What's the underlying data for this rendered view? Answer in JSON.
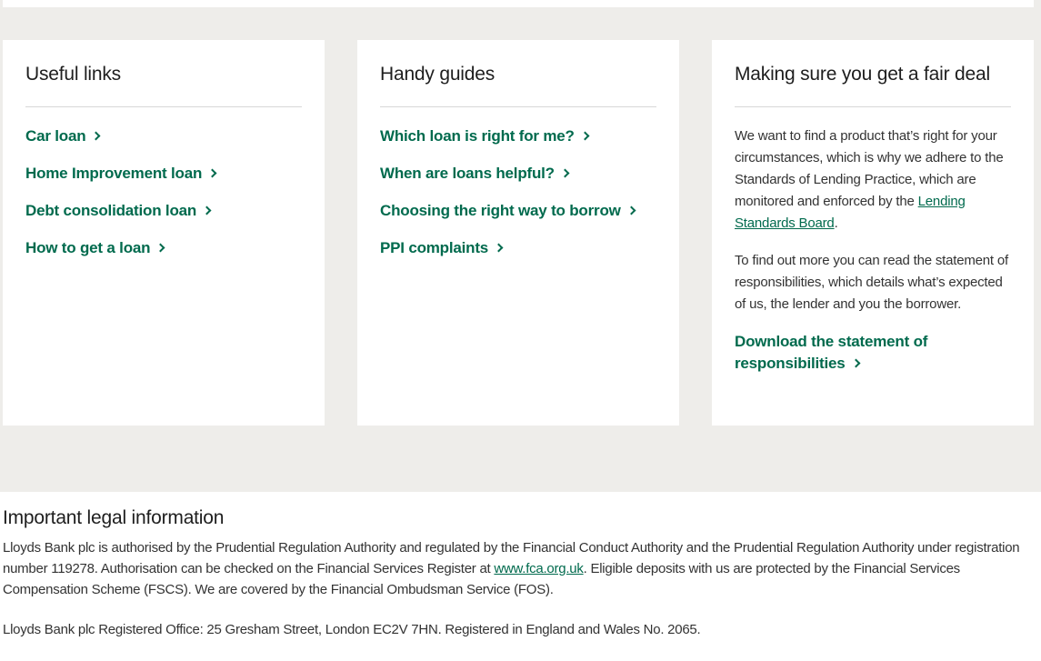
{
  "useful_links": {
    "title": "Useful links",
    "items": [
      {
        "label": "Car loan"
      },
      {
        "label": "Home Improvement loan"
      },
      {
        "label": "Debt consolidation loan"
      },
      {
        "label": "How to get a loan"
      }
    ]
  },
  "handy_guides": {
    "title": "Handy guides",
    "items": [
      {
        "label": "Which loan is right for me?"
      },
      {
        "label": "When are loans helpful?"
      },
      {
        "label": "Choosing the right way to borrow"
      },
      {
        "label": "PPI complaints"
      }
    ]
  },
  "fair_deal": {
    "title": "Making sure you get a fair deal",
    "para1_text": "We want to find a product that’s right for your circumstances, which is why we adhere to the Standards of Lending Practice, which are monitored and enforced by the ",
    "para1_link": "Lending Standards Board",
    "para1_end": ".",
    "para2": "To find out more you can read the statement of responsibilities, which details what’s expected of us, the lender and you the borrower.",
    "download_label": "Download the statement of responsibilities"
  },
  "legal": {
    "title": "Important legal information",
    "para1_text": "Lloyds Bank plc is authorised by the Prudential Regulation Authority and regulated by the Financial Conduct Authority and the Prudential Regulation Authority under registration number 119278. Authorisation can be checked on the Financial Services Register at ",
    "para1_link": "www.fca.org.uk",
    "para1_end": ". Eligible deposits with us are protected by the Financial Services Compensation Scheme (FSCS). We are covered by the Financial Ombudsman Service (FOS).",
    "para2": "Lloyds Bank plc Registered Office: 25 Gresham Street, London EC2V 7HN. Registered in England and Wales No. 2065."
  },
  "colors": {
    "link_green": "#006a4d",
    "background_grey": "#eeedea",
    "heading": "#1e1e1e",
    "body_text": "#333333"
  }
}
